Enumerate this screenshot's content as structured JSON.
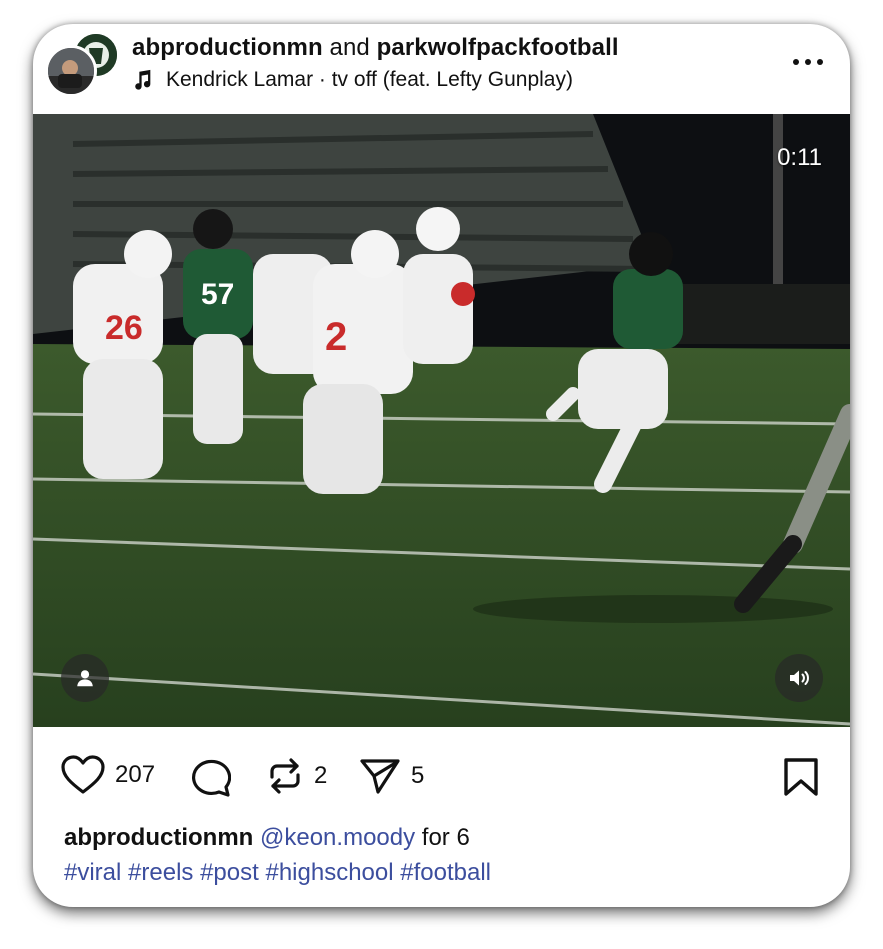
{
  "post": {
    "author_primary": "abproductionmn",
    "author_joiner": "and",
    "author_secondary": "parkwolfpackfootball",
    "music": "Kendrick Lamar · tv off (feat. Lefty Gunplay)",
    "video_time": "0:11"
  },
  "actions": {
    "likes": "207",
    "reposts": "2",
    "shares": "5"
  },
  "caption": {
    "user": "abproductionmn",
    "mention": "@keon.moody",
    "text": "for 6",
    "hashtags": [
      "#viral",
      "#reels",
      "#post",
      "#highschool",
      "#football"
    ]
  },
  "icons": {
    "more": "more-dots-icon",
    "music": "music-note-icon",
    "like": "heart-icon",
    "comment": "comment-bubble-icon",
    "repost": "repost-icon",
    "share": "send-icon",
    "save": "bookmark-icon",
    "user_tag": "person-icon",
    "sound": "speaker-icon"
  },
  "colors": {
    "link": "#3c4e9e",
    "field_green": "#2f4a26",
    "home_jersey": "#1f5a35"
  }
}
